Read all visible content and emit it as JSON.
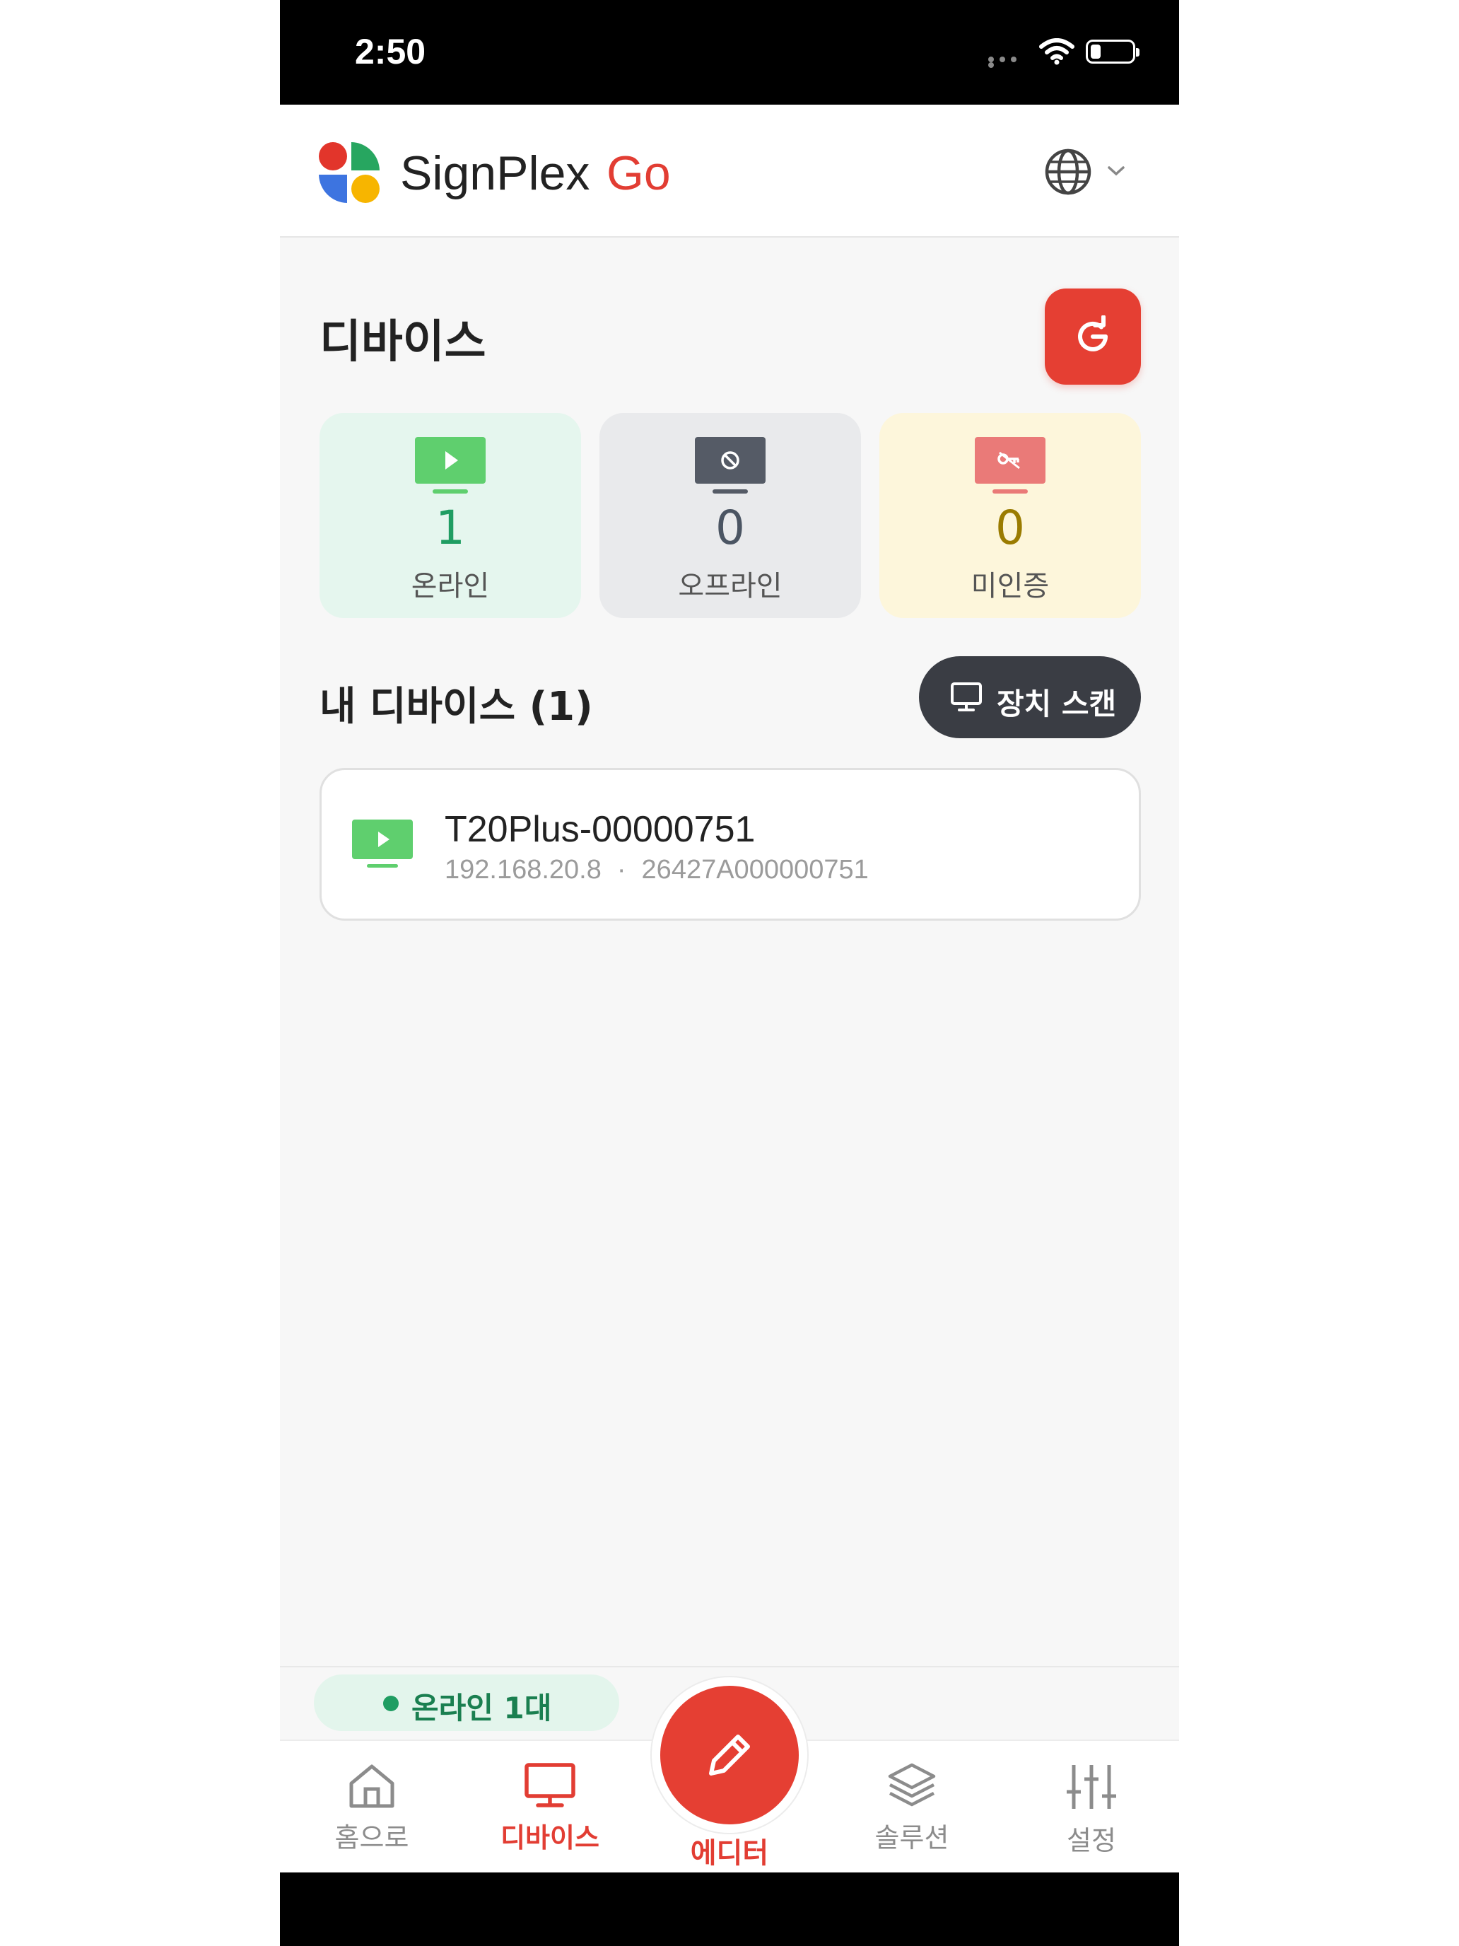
{
  "status_bar": {
    "time": "2:50"
  },
  "header": {
    "app_name": "SignPlex",
    "app_name_accent": "Go",
    "language_icon": "globe-icon"
  },
  "page": {
    "title": "디바이스",
    "refresh_icon": "refresh-icon"
  },
  "stats": {
    "online": {
      "count": "1",
      "label": "온라인",
      "color": "#1f9d62",
      "bg": "#e5f6ee",
      "icon": "monitor-play-icon"
    },
    "offline": {
      "count": "0",
      "label": "오프라인",
      "color": "#4b5563",
      "bg": "#e9eaec",
      "icon": "monitor-blocked-icon"
    },
    "unauthorized": {
      "count": "0",
      "label": "미인증",
      "color": "#9a7b00",
      "bg": "#fdf6db",
      "icon": "monitor-key-icon"
    }
  },
  "my_devices": {
    "title": "내 디바이스 (1)",
    "search_icon": "search-icon",
    "scan_label": "장치 스캔"
  },
  "devices": [
    {
      "name": "T20Plus-00000751",
      "ip": "192.168.20.8",
      "separator": "·",
      "serial": "26427A000000751",
      "status": "online"
    }
  ],
  "footer": {
    "online_summary": "온라인 1대"
  },
  "nav": {
    "home": "홈으로",
    "devices": "디바이스",
    "editor": "에디터",
    "solutions": "솔루션",
    "settings": "설정"
  },
  "colors": {
    "accent": "#e53f33",
    "online": "#1f9d62",
    "dark_button": "#3a3d44"
  }
}
